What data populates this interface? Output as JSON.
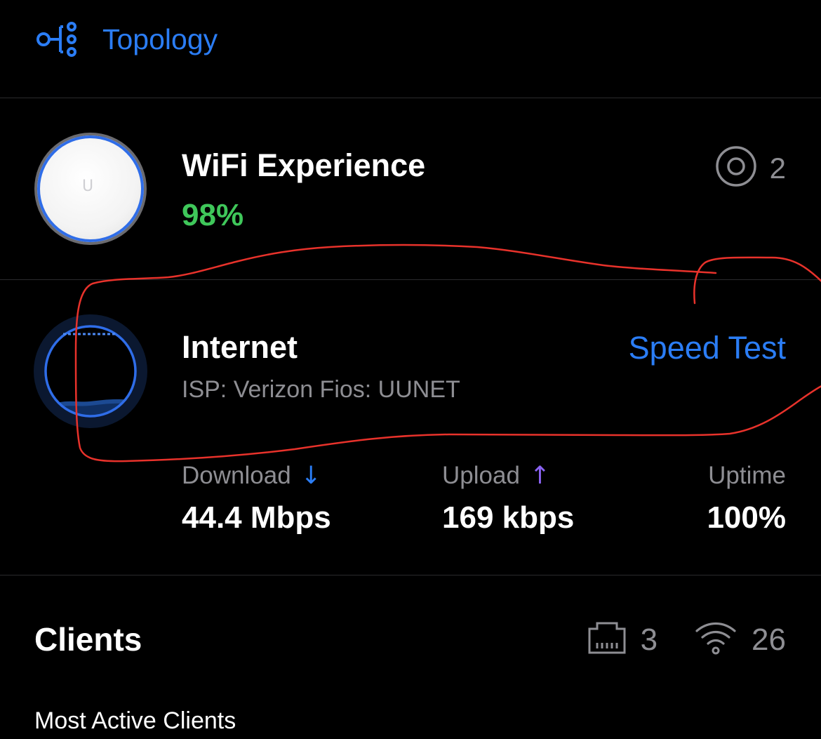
{
  "header": {
    "title": "Topology",
    "icon": "topology-icon",
    "accent_color": "#2b7df5"
  },
  "wifi": {
    "title": "WiFi Experience",
    "score": "98%",
    "access_points_count": "2",
    "score_color": "#3fc75a",
    "device_logo": "U"
  },
  "internet": {
    "title": "Internet",
    "isp": "ISP: Verizon Fios: UUNET",
    "speed_test_label": "Speed Test"
  },
  "stats": {
    "download_label": "Download",
    "download_value": "44.4 Mbps",
    "upload_label": "Upload",
    "upload_value": "169 kbps",
    "uptime_label": "Uptime",
    "uptime_value": "100%",
    "download_arrow": "↓",
    "upload_arrow": "↑",
    "download_arrow_color": "#2b7df5",
    "upload_arrow_color": "#8a63f2"
  },
  "clients": {
    "title": "Clients",
    "wired_count": "3",
    "wireless_count": "26",
    "subtitle": "Most Active Clients"
  },
  "annotation": {
    "color": "#e8322b",
    "description_shape": "hand-drawn-outline"
  }
}
